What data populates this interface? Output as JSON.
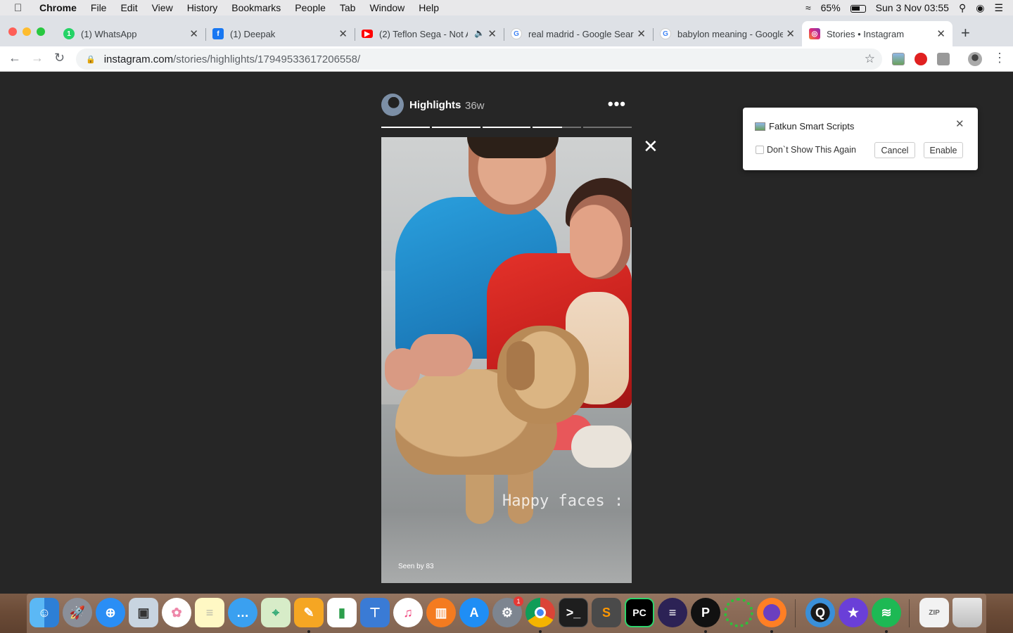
{
  "menubar": {
    "apple": "",
    "app_name": "Chrome",
    "items": [
      "File",
      "Edit",
      "View",
      "History",
      "Bookmarks",
      "People",
      "Tab",
      "Window",
      "Help"
    ],
    "battery": "65%",
    "clock": "Sun 3 Nov  03:55"
  },
  "tabs": [
    {
      "title": "(1) WhatsApp",
      "favicon": "whatsapp-icon",
      "color": "#25d366"
    },
    {
      "title": "(1) Deepak",
      "favicon": "facebook-icon",
      "color": "#1877f2"
    },
    {
      "title": "(2) Teflon Sega - Not A",
      "favicon": "youtube-icon",
      "color": "#ff0000"
    },
    {
      "title": "real madrid - Google Search",
      "favicon": "google-icon",
      "color": "#4285f4"
    },
    {
      "title": "babylon meaning - Google Search",
      "favicon": "google-icon",
      "color": "#4285f4"
    },
    {
      "title": "Stories • Instagram",
      "favicon": "instagram-icon",
      "color": "#e1306c"
    }
  ],
  "omnibox": {
    "host": "instagram.com",
    "path": "/stories/highlights/17949533617206558/"
  },
  "story": {
    "username": "Highlights",
    "time": "36w",
    "caption": "Happy faces :",
    "seen": "Seen by 83",
    "progress_segments": [
      1,
      1,
      1,
      0.6,
      0
    ]
  },
  "popup": {
    "title": "Fatkun Smart Scripts",
    "dont_show": "Don`t Show This Again",
    "cancel": "Cancel",
    "enable": "Enable"
  },
  "dock": {
    "badge": "1",
    "apps": [
      "finder-icon",
      "launchpad-icon",
      "safari-icon",
      "preview-icon",
      "photos-icon",
      "notes-icon",
      "messages-icon",
      "maps-icon",
      "pages-icon",
      "numbers-icon",
      "keynote-icon",
      "itunes-icon",
      "books-icon",
      "app-store-icon",
      "system-preferences-icon",
      "chrome-icon",
      "terminal-icon",
      "sublime-text-icon",
      "pycharm-icon",
      "eclipse-icon",
      "p-app-icon",
      "spinner-app-icon",
      "firefox-icon",
      "quicktime-icon",
      "imovie-icon",
      "spotify-icon",
      "archive-icon",
      "trash-icon"
    ]
  }
}
